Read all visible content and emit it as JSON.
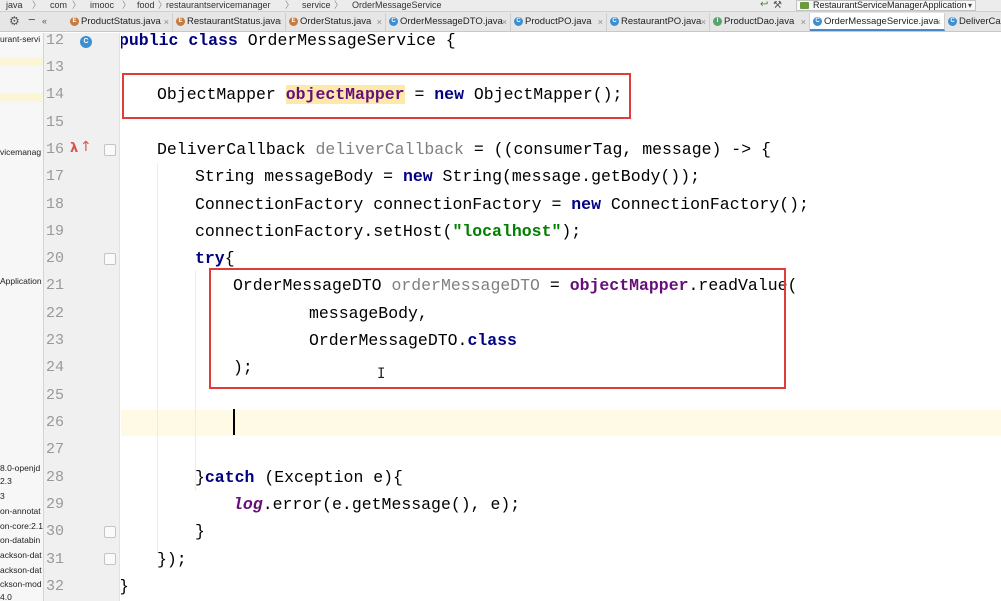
{
  "breadcrumb": {
    "items": [
      "java",
      "com",
      "imooc",
      "food",
      "restaurantservicemanager",
      "service",
      "OrderMessageService"
    ]
  },
  "run_config": {
    "label": "RestaurantServiceManagerApplication"
  },
  "tabs": [
    {
      "label": "ProductStatus.java",
      "icon": "e"
    },
    {
      "label": "RestaurantStatus.java",
      "icon": "e"
    },
    {
      "label": "OrderStatus.java",
      "icon": "e"
    },
    {
      "label": "OrderMessageDTO.java",
      "icon": "c"
    },
    {
      "label": "ProductPO.java",
      "icon": "c"
    },
    {
      "label": "RestaurantPO.java",
      "icon": "c"
    },
    {
      "label": "ProductDao.java",
      "icon": "i"
    },
    {
      "label": "OrderMessageService.java",
      "icon": "c",
      "active": true
    },
    {
      "label": "DeliverCa",
      "icon": "c"
    }
  ],
  "sidebar": {
    "items": [
      "urant-servi",
      "vicemanag",
      "Application",
      "8.0-openjd",
      "2.3",
      "3",
      "on-annotat",
      "on-core:2.1",
      "on-databin",
      "ackson-dat",
      "ackson-dat",
      "ckson-mod",
      "4.0"
    ]
  },
  "line_numbers": [
    "12",
    "13",
    "14",
    "15",
    "16",
    "17",
    "18",
    "19",
    "20",
    "21",
    "22",
    "23",
    "24",
    "25",
    "26",
    "27",
    "28",
    "29",
    "30",
    "31",
    "32"
  ],
  "code": {
    "l12_kw1": "public",
    "l12_kw2": "class",
    "l12_name": "OrderMessageService {",
    "l14_type": "ObjectMapper ",
    "l14_field": "objectMapper",
    "l14_eq": " = ",
    "l14_new": "new",
    "l14_rest": " ObjectMapper();",
    "l16_type": "DeliverCallback ",
    "l16_field": "deliverCallback",
    "l16_rest": " = ((consumerTag, message) -> {",
    "l17_a": "String messageBody = ",
    "l17_new": "new",
    "l17_b": " String(message.getBody());",
    "l18_a": "ConnectionFactory connectionFactory = ",
    "l18_new": "new",
    "l18_b": " ConnectionFactory();",
    "l19_a": "connectionFactory.setHost(",
    "l19_str": "\"localhost\"",
    "l19_b": ");",
    "l20_try": "try",
    "l20_b": "{",
    "l21_type": "OrderMessageDTO ",
    "l21_var": "orderMessageDTO",
    "l21_eq": " = ",
    "l21_field": "objectMapper",
    "l21_rest": ".readValue(",
    "l22": "messageBody,",
    "l23_a": "OrderMessageDTO.",
    "l23_kw": "class",
    "l24": ");",
    "l28_a": "}",
    "l28_kw": "catch",
    "l28_b": " (Exception e){",
    "l29_log": "log",
    "l29_b": ".error(e.getMessage(), e);",
    "l30": "}",
    "l31": "});",
    "l32": "}"
  },
  "colors": {
    "keyword": "#000080",
    "field": "#660e7a",
    "string": "#008000",
    "annotation_box": "#e03c3c"
  }
}
